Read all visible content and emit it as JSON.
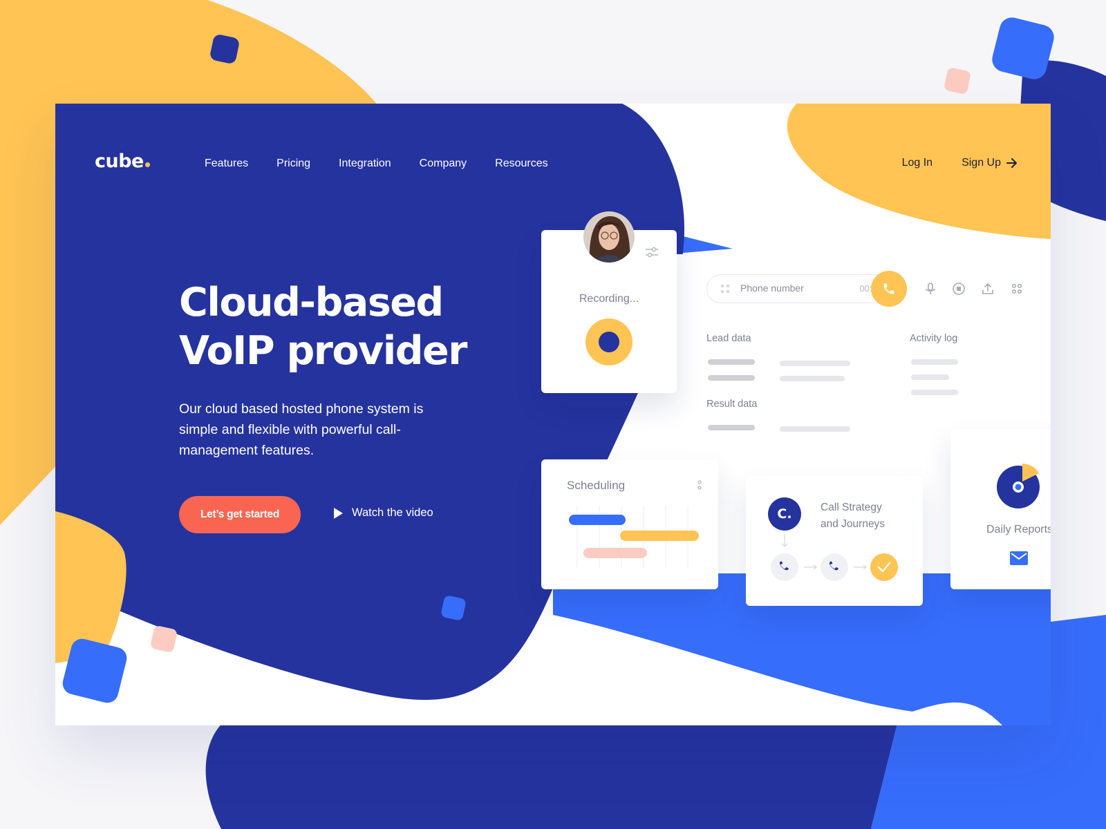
{
  "colors": {
    "navy": "#25339e",
    "blue": "#376dfb",
    "yellow": "#ffc453",
    "coral": "#fa6552",
    "pink": "#fcccc3",
    "text_dark": "#1a1f3d"
  },
  "brand": {
    "logo": "cube"
  },
  "nav": {
    "items": [
      "Features",
      "Pricing",
      "Integration",
      "Company",
      "Resources"
    ]
  },
  "auth": {
    "login": "Log In",
    "signup": "Sign Up"
  },
  "hero": {
    "title_line1": "Cloud-based",
    "title_line2": "VoIP provider",
    "subtitle": "Our cloud based hosted phone system is simple and flexible with powerful call-management features.",
    "cta": "Let’s get started",
    "watch": "Watch the video"
  },
  "recording_card": {
    "status": "Recording..."
  },
  "call_panel": {
    "phone_placeholder": "Phone number",
    "timer": "00:00",
    "lead_data": "Lead data",
    "activity_log": "Activity log",
    "result_data": "Result data"
  },
  "scheduling_card": {
    "title": "Scheduling"
  },
  "strategy_card": {
    "title_line1": "Call Strategy",
    "title_line2": "and Journeys",
    "badge": "C."
  },
  "reports_card": {
    "title": "Daily Reports"
  },
  "icons": {
    "arrow": "arrow-right-icon",
    "play": "play-icon",
    "settings": "sliders-icon",
    "phone": "phone-icon",
    "mic": "microphone-icon",
    "stop": "stop-icon",
    "upload": "upload-icon",
    "grid": "grid-icon",
    "more": "more-vertical-icon",
    "check": "check-icon",
    "mail": "mail-icon",
    "chart": "pie-chart-icon"
  }
}
